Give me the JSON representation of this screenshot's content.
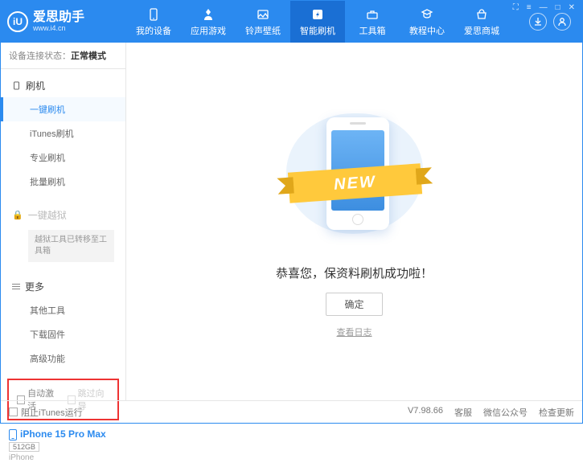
{
  "header": {
    "logo_text": "爱思助手",
    "logo_url": "www.i4.cn",
    "logo_badge": "iU",
    "nav": [
      {
        "label": "我的设备"
      },
      {
        "label": "应用游戏"
      },
      {
        "label": "铃声壁纸"
      },
      {
        "label": "智能刷机"
      },
      {
        "label": "工具箱"
      },
      {
        "label": "教程中心"
      },
      {
        "label": "爱思商城"
      }
    ]
  },
  "sidebar": {
    "conn_label": "设备连接状态：",
    "conn_value": "正常模式",
    "section_flash": "刷机",
    "items_flash": [
      {
        "label": "一键刷机"
      },
      {
        "label": "iTunes刷机"
      },
      {
        "label": "专业刷机"
      },
      {
        "label": "批量刷机"
      }
    ],
    "section_jailbreak": "一键越狱",
    "jailbreak_note": "越狱工具已转移至工具箱",
    "section_more": "更多",
    "items_more": [
      {
        "label": "其他工具"
      },
      {
        "label": "下载固件"
      },
      {
        "label": "高级功能"
      }
    ],
    "cb_auto_activate": "自动激活",
    "cb_skip_guide": "跳过向导",
    "device": {
      "name": "iPhone 15 Pro Max",
      "storage": "512GB",
      "model": "iPhone"
    }
  },
  "main": {
    "ribbon": "NEW",
    "success_msg": "恭喜您，保资料刷机成功啦！",
    "confirm": "确定",
    "view_log": "查看日志"
  },
  "footer": {
    "block_itunes": "阻止iTunes运行",
    "version": "V7.98.66",
    "links": [
      "客服",
      "微信公众号",
      "检查更新"
    ]
  },
  "win": {
    "cart": "⛶",
    "menu": "≡",
    "min": "—",
    "max": "□",
    "close": "✕"
  }
}
